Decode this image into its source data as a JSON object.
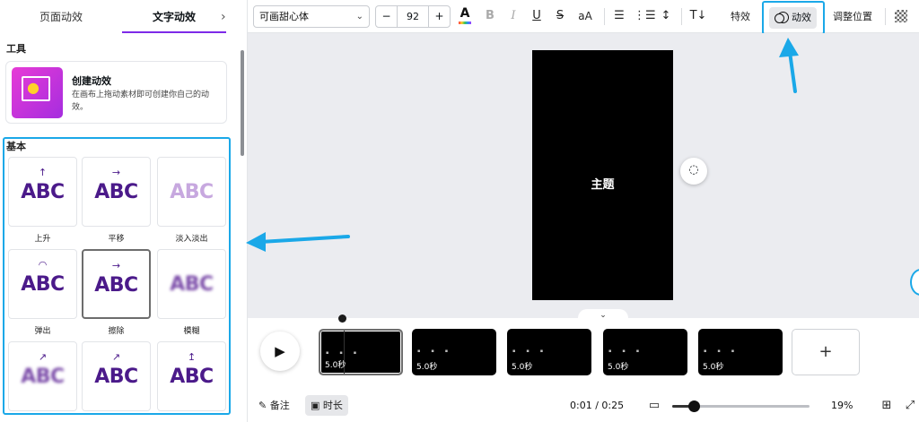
{
  "panel": {
    "tabs": [
      "页面动效",
      "文字动效"
    ],
    "tab_chevron": "›",
    "tools_heading": "工具",
    "tool_card": {
      "title": "创建动效",
      "desc": "在画布上拖动素材即可创建你自己的动效。"
    },
    "basic_heading": "基本",
    "animations": [
      {
        "label": "上升",
        "preview": "ABC",
        "arrow": "↑",
        "style": "plain"
      },
      {
        "label": "平移",
        "preview": "ABC",
        "arrow": "→",
        "style": "plain"
      },
      {
        "label": "淡入淡出",
        "preview": "ABC",
        "arrow": "",
        "style": "fade"
      },
      {
        "label": "弹出",
        "preview": "ABC",
        "arrow": "◠",
        "style": "plain"
      },
      {
        "label": "擦除",
        "preview": "ABC",
        "arrow": "→",
        "style": "plain",
        "selected": true
      },
      {
        "label": "模糊",
        "preview": "ABC",
        "arrow": "",
        "style": "blur"
      },
      {
        "label": "",
        "preview": "ABC",
        "arrow": "↗",
        "style": "blur"
      },
      {
        "label": "",
        "preview": "ABC",
        "arrow": "↗",
        "style": "plain"
      },
      {
        "label": "",
        "preview": "ABC",
        "arrow": "↥",
        "style": "plain"
      }
    ]
  },
  "toolbar": {
    "font": "可画甜心体",
    "font_size": "92",
    "minus": "−",
    "plus": "+",
    "effects_label": "特效",
    "animate_label": "动效",
    "position_label": "调整位置"
  },
  "canvas": {
    "page_text": "主题",
    "collapse": "⌄"
  },
  "timeline": {
    "clips": [
      {
        "duration": "5.0秒"
      },
      {
        "duration": "5.0秒"
      },
      {
        "duration": "5.0秒"
      },
      {
        "duration": "5.0秒"
      },
      {
        "duration": "5.0秒"
      }
    ],
    "add": "+"
  },
  "bottom": {
    "notes_label": "备注",
    "duration_label": "时长",
    "timecode": "0:01 / 0:25",
    "zoom": "19%",
    "zoom_fraction": 0.16
  }
}
